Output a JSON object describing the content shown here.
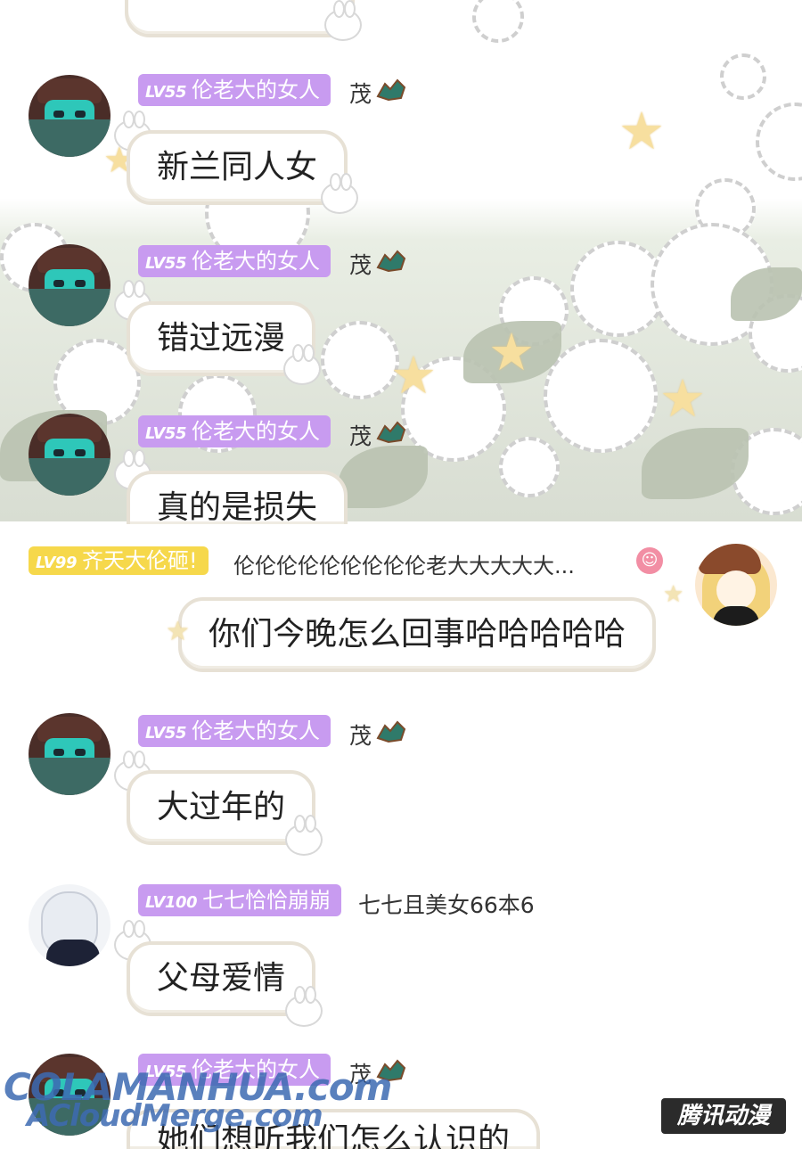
{
  "messages": [
    {
      "id": "m0",
      "badge": {
        "level": "",
        "name": ""
      },
      "suffix": "",
      "text": "",
      "partial": true
    },
    {
      "id": "m1",
      "badge": {
        "level": "LV55",
        "name": "伦老大的女人"
      },
      "suffix": "茂",
      "text": "新兰同人女"
    },
    {
      "id": "m2",
      "badge": {
        "level": "LV55",
        "name": "伦老大的女人"
      },
      "suffix": "茂",
      "text": "错过远漫"
    },
    {
      "id": "m3",
      "badge": {
        "level": "LV55",
        "name": "伦老大的女人"
      },
      "suffix": "茂",
      "text": "真的是损失"
    },
    {
      "id": "m4",
      "badge": {
        "level": "LV99",
        "name": "齐天大伦砸!"
      },
      "suffix": "伦伦伦伦伦伦伦伦伦老大大大大大...",
      "text": "你们今晚怎么回事哈哈哈哈哈",
      "self": true
    },
    {
      "id": "m5",
      "badge": {
        "level": "LV55",
        "name": "伦老大的女人"
      },
      "suffix": "茂",
      "text": "大过年的"
    },
    {
      "id": "m6",
      "badge": {
        "level": "LV100",
        "name": "七七恰恰崩崩"
      },
      "suffix": "七七且美女66本6",
      "text": "父母爱情"
    },
    {
      "id": "m7",
      "badge": {
        "level": "LV55",
        "name": "伦老大的女人"
      },
      "suffix": "茂",
      "text": "她们想听我们怎么认识的"
    }
  ],
  "watermark": {
    "line1": "COLAMANHUA.com",
    "line2": "ACloudMerge.com",
    "brand": "腾讯动漫"
  },
  "icons": {
    "robot_avatar": "robot-avatar",
    "girl_avatar": "girl-avatar",
    "anime_avatar": "anime-avatar",
    "emblem": "dragon-emblem-icon",
    "bunny": "bunny-sticker-icon",
    "heart": "heart-badge-icon"
  },
  "colors": {
    "badge_purple": "#c89bf0",
    "badge_yellow": "#f6d84b",
    "bubble_border": "#e7e1d5"
  }
}
